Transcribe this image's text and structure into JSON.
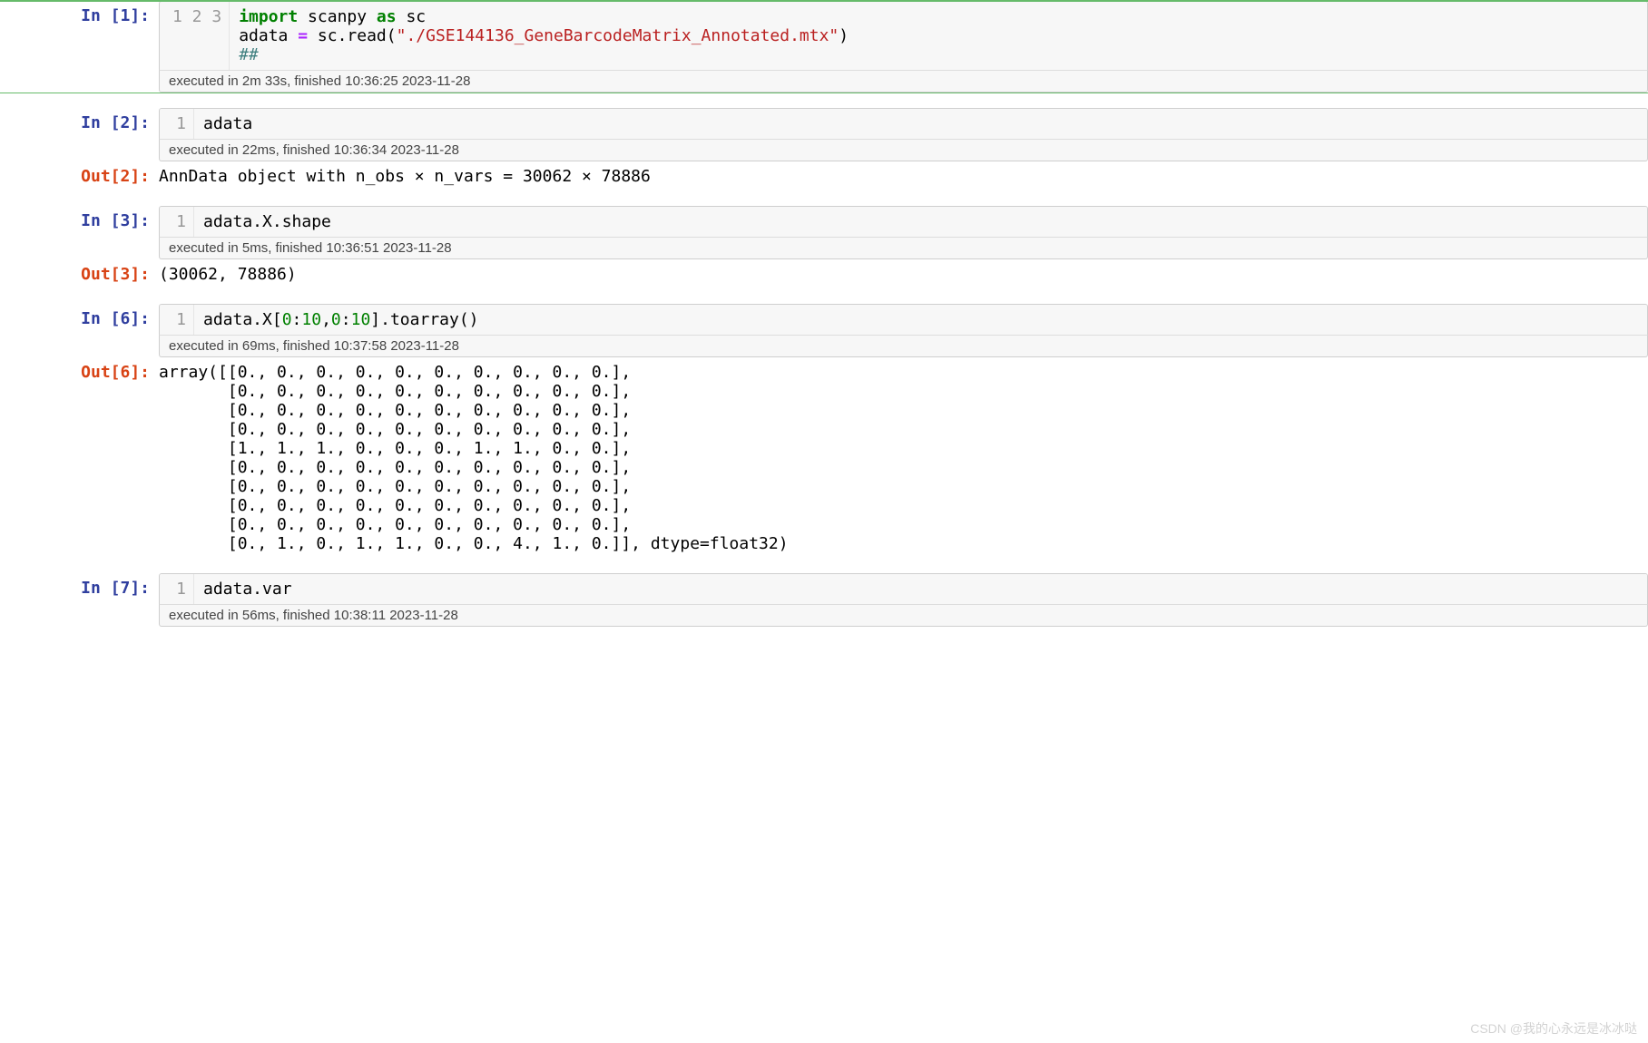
{
  "cells": [
    {
      "kind": "code",
      "selected": true,
      "in_prompt": "In [1]:",
      "gutter": "1\n2\n3",
      "code_lines": [
        [
          {
            "t": "import",
            "c": "kw"
          },
          {
            "t": " scanpy "
          },
          {
            "t": "as",
            "c": "kw"
          },
          {
            "t": " sc"
          }
        ],
        [
          {
            "t": "adata "
          },
          {
            "t": "=",
            "c": "op"
          },
          {
            "t": " sc"
          },
          {
            "t": ".",
            "c": ""
          },
          {
            "t": "read("
          },
          {
            "t": "\"./GSE144136_GeneBarcodeMatrix_Annotated.mtx\"",
            "c": "str"
          },
          {
            "t": ")"
          }
        ],
        [
          {
            "t": "##",
            "c": "cm"
          }
        ]
      ],
      "exec_info": "executed in 2m 33s, finished 10:36:25 2023-11-28"
    },
    {
      "kind": "code",
      "in_prompt": "In [2]:",
      "gutter": "1",
      "code_lines": [
        [
          {
            "t": "adata"
          }
        ]
      ],
      "exec_info": "executed in 22ms, finished 10:36:34 2023-11-28",
      "out_prompt": "Out[2]:",
      "output": "AnnData object with n_obs × n_vars = 30062 × 78886"
    },
    {
      "kind": "code",
      "in_prompt": "In [3]:",
      "gutter": "1",
      "code_lines": [
        [
          {
            "t": "adata"
          },
          {
            "t": "."
          },
          {
            "t": "X"
          },
          {
            "t": "."
          },
          {
            "t": "shape"
          }
        ]
      ],
      "exec_info": "executed in 5ms, finished 10:36:51 2023-11-28",
      "out_prompt": "Out[3]:",
      "output": "(30062, 78886)"
    },
    {
      "kind": "code",
      "in_prompt": "In [6]:",
      "gutter": "1",
      "code_lines": [
        [
          {
            "t": "adata"
          },
          {
            "t": "."
          },
          {
            "t": "X["
          },
          {
            "t": "0",
            "c": "num"
          },
          {
            "t": ":"
          },
          {
            "t": "10",
            "c": "num"
          },
          {
            "t": ","
          },
          {
            "t": "0",
            "c": "num"
          },
          {
            "t": ":"
          },
          {
            "t": "10",
            "c": "num"
          },
          {
            "t": "]"
          },
          {
            "t": "."
          },
          {
            "t": "toarray()"
          }
        ]
      ],
      "exec_info": "executed in 69ms, finished 10:37:58 2023-11-28",
      "out_prompt": "Out[6]:",
      "output": "array([[0., 0., 0., 0., 0., 0., 0., 0., 0., 0.],\n       [0., 0., 0., 0., 0., 0., 0., 0., 0., 0.],\n       [0., 0., 0., 0., 0., 0., 0., 0., 0., 0.],\n       [0., 0., 0., 0., 0., 0., 0., 0., 0., 0.],\n       [1., 1., 1., 0., 0., 0., 1., 1., 0., 0.],\n       [0., 0., 0., 0., 0., 0., 0., 0., 0., 0.],\n       [0., 0., 0., 0., 0., 0., 0., 0., 0., 0.],\n       [0., 0., 0., 0., 0., 0., 0., 0., 0., 0.],\n       [0., 0., 0., 0., 0., 0., 0., 0., 0., 0.],\n       [0., 1., 0., 1., 1., 0., 0., 4., 1., 0.]], dtype=float32)"
    },
    {
      "kind": "code",
      "in_prompt": "In [7]:",
      "gutter": "1",
      "code_lines": [
        [
          {
            "t": "adata"
          },
          {
            "t": "."
          },
          {
            "t": "var"
          }
        ]
      ],
      "exec_info": "executed in 56ms, finished 10:38:11 2023-11-28"
    }
  ],
  "watermark": "CSDN @我的心永远是冰冰哒"
}
